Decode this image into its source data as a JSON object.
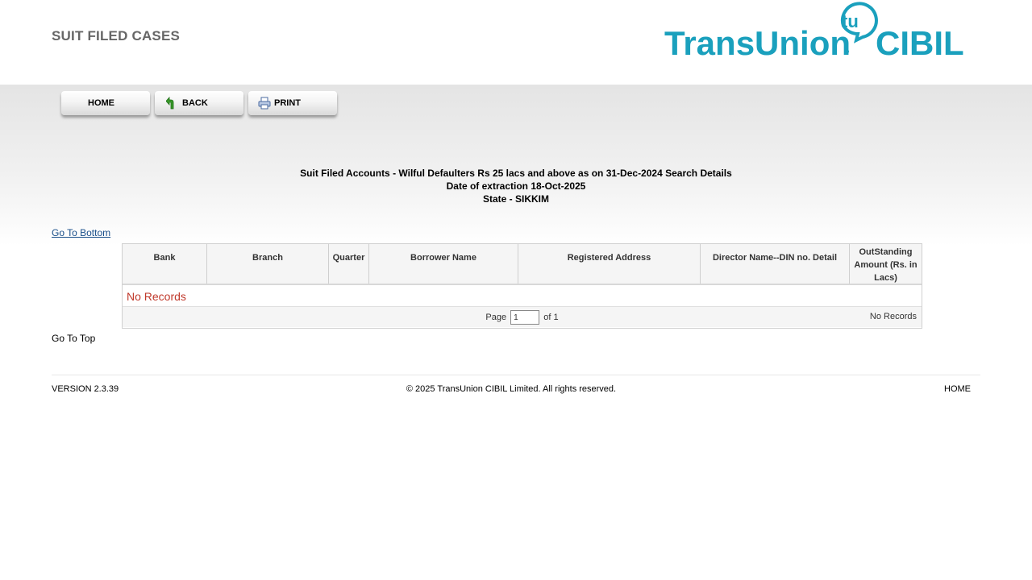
{
  "header": {
    "page_heading": "SUIT FILED CASES",
    "logo": {
      "name": "TransUnion CIBIL logo",
      "text": "TransUnion",
      "text2": "CIBIL",
      "mark": "tu",
      "color": "#1aa0bd"
    }
  },
  "toolbar": {
    "home_label": "HOME",
    "back_label": "BACK",
    "print_label": "PRINT"
  },
  "info": {
    "line1": "Suit Filed Accounts - Wilful Defaulters Rs 25 lacs and above as on 31-Dec-2024 Search Details",
    "line2": "Date of extraction 18-Oct-2025",
    "line3": "State - SIKKIM"
  },
  "links": {
    "go_to_bottom": "Go To Bottom",
    "go_to_top": "Go To Top"
  },
  "grid": {
    "columns": [
      "Bank",
      "Branch",
      "Quarter",
      "Borrower Name",
      "Registered Address",
      "Director Name--DIN no. Detail",
      "OutStanding Amount (Rs. in Lacs)"
    ],
    "empty_message": "No Records",
    "pager": {
      "page_label": "Page",
      "page_value": "1",
      "of_label": "of 1",
      "records_label": "No Records"
    }
  },
  "footer": {
    "version": "VERSION 2.3.39",
    "copyright": "© 2025 TransUnion CIBIL Limited. All rights reserved.",
    "home": "HOME"
  }
}
